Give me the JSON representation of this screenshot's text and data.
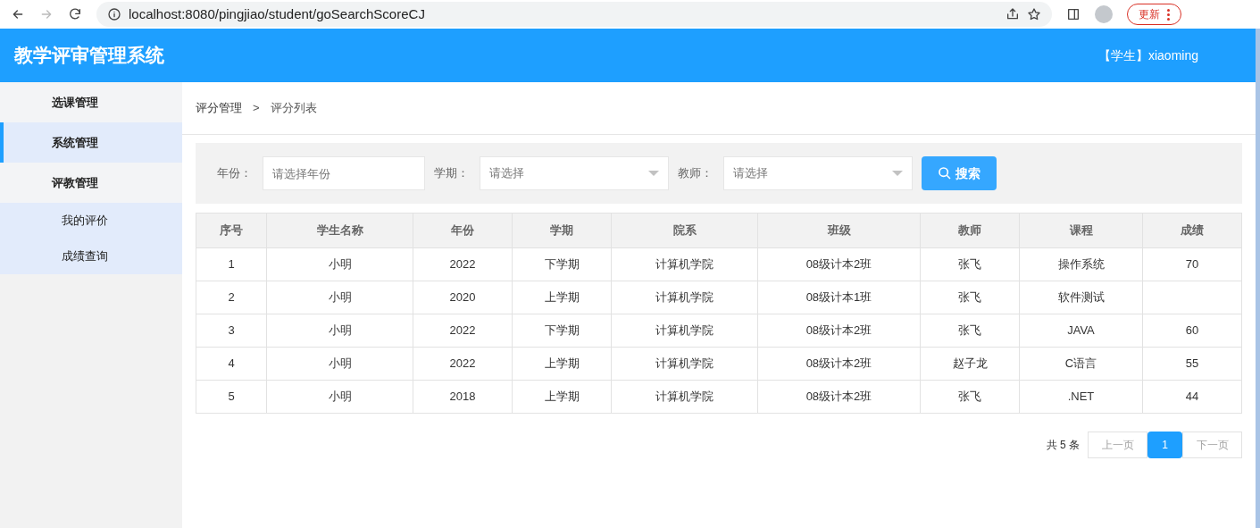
{
  "browser": {
    "url": "localhost:8080/pingjiao/student/goSearchScoreCJ",
    "forward_disabled": true,
    "update_button": "更新"
  },
  "header": {
    "title": "教学评审管理系统",
    "user": "【学生】xiaoming"
  },
  "sidebar": {
    "items": [
      {
        "label": "选课管理",
        "selected": false
      },
      {
        "label": "系统管理",
        "selected": true
      },
      {
        "label": "评教管理",
        "selected": false,
        "expanded": true,
        "children": [
          {
            "label": "我的评价",
            "selected": false
          },
          {
            "label": "成绩查询",
            "selected": false
          }
        ]
      }
    ]
  },
  "breadcrumb": [
    "评分管理",
    "评分列表"
  ],
  "breadcrumb_separator": ">",
  "filters": [
    {
      "kind": "input",
      "label": "年份：",
      "placeholder": "请选择年份"
    },
    {
      "kind": "select",
      "label": "学期：",
      "placeholder": "请选择"
    },
    {
      "kind": "select",
      "label": "教师：",
      "placeholder": "请选择"
    }
  ],
  "search_button": "搜索",
  "table": {
    "columns": [
      "序号",
      "学生名称",
      "年份",
      "学期",
      "院系",
      "班级",
      "教师",
      "课程",
      "成绩"
    ],
    "rows": [
      [
        "1",
        "小明",
        "2022",
        "下学期",
        "计算机学院",
        "08级计本2班",
        "张飞",
        "操作系统",
        "70"
      ],
      [
        "2",
        "小明",
        "2020",
        "上学期",
        "计算机学院",
        "08级计本1班",
        "张飞",
        "软件测试",
        ""
      ],
      [
        "3",
        "小明",
        "2022",
        "下学期",
        "计算机学院",
        "08级计本2班",
        "张飞",
        "JAVA",
        "60"
      ],
      [
        "4",
        "小明",
        "2022",
        "上学期",
        "计算机学院",
        "08级计本2班",
        "赵子龙",
        "C语言",
        "55"
      ],
      [
        "5",
        "小明",
        "2018",
        "上学期",
        "计算机学院",
        "08级计本2班",
        "张飞",
        ".NET",
        "44"
      ]
    ]
  },
  "pagination": {
    "total": "共 5 条",
    "prev": {
      "label": "上一页",
      "disabled": true
    },
    "pages": [
      {
        "label": "1",
        "selected": true
      }
    ],
    "next": {
      "label": "下一页",
      "disabled": true
    }
  }
}
